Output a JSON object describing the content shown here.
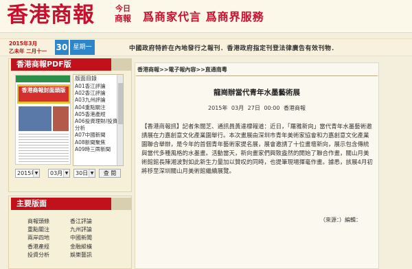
{
  "header": {
    "logo": "香港商報",
    "logo_sub_1": "今日",
    "logo_sub_2": "商報",
    "slogan": "爲商家代言 爲商界服務"
  },
  "datebar": {
    "date_line1": "2015年3月",
    "date_line2": "乙未年 二月十一",
    "day": "30",
    "weekday": "星期一",
    "ticker": "中國政府特許在內地發行之報刊．香港政府指定刊登法律廣告有效刊物．"
  },
  "pdf": {
    "title": "香港商報PDF版",
    "thumb_headline": "香港商報封面頭版",
    "list_header": "版面目錄",
    "list_items": [
      "A01香江評論",
      "A02香江評論",
      "A03九州評論",
      "A04重點關注",
      "A05香港產經",
      "A06投資理財/投資",
      "分析",
      "A07中國新聞",
      "A08新聞聚焦",
      "A09時三兩新聞"
    ],
    "year": "2015年",
    "month": "03月",
    "day": "30日",
    "go_label": "查 閱"
  },
  "main_sections": {
    "title": "主要版面",
    "rows": [
      [
        "商報頭條",
        "香江評論"
      ],
      [
        "重點關注",
        "九州評論"
      ],
      [
        "兩岸四地",
        "中國新聞"
      ],
      [
        "香港產經",
        "金融縱橫"
      ],
      [
        "投資分析",
        "娛樂藝訊"
      ]
    ]
  },
  "article": {
    "breadcrumb": "香港商報>>電子報內容>>直通南粵",
    "title": "龍崗辦當代青年水墨藝術展",
    "meta": "2015年 03月 27日 00:00   香港商報",
    "body": [
      "【香港商報訊】記者朱闊芝、通訊員黃達標報道：近日，「羅雅新向」當代青年水墨藝術邀請展在力嘉創意文化產業園舉行。本次畫展由深圳市青年美術家協會和力嘉創意文化產業園聯合舉辦，是今年的首個青年藝術家提名展，展會邀請了十位畫壇新向，展示包含傳統與當代多種風格的水墨畫。活動當天，新向畫家們興致盎然的開始了聯合作畫，關山月美術館館長陳湘波對如此新生力量加以贊叹的同時，也提筆現場揮毫作畫。據悉，該展4月初將移至深圳關山月美術館繼續展覽。"
    ],
    "footer": "（來源：）編輯："
  }
}
